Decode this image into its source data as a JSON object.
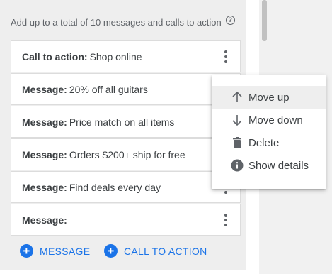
{
  "header": {
    "text": "Add up to a total of 10 messages and calls to action",
    "help_symbol": "?"
  },
  "rows": [
    {
      "label": "Call to action:",
      "value": "Shop online"
    },
    {
      "label": "Message:",
      "value": "20% off all guitars"
    },
    {
      "label": "Message:",
      "value": "Price match on all items"
    },
    {
      "label": "Message:",
      "value": "Orders $200+ ship for free"
    },
    {
      "label": "Message:",
      "value": "Find deals every day"
    },
    {
      "label": "Message:",
      "value": ""
    }
  ],
  "add_buttons": {
    "message": "MESSAGE",
    "call_to_action": "CALL TO ACTION",
    "plus_symbol": "+"
  },
  "menu": {
    "items": [
      {
        "label": "Move up",
        "icon": "arrow-up-icon"
      },
      {
        "label": "Move down",
        "icon": "arrow-down-icon"
      },
      {
        "label": "Delete",
        "icon": "trash-icon"
      },
      {
        "label": "Show details",
        "icon": "info-icon"
      }
    ],
    "highlighted_index": 0,
    "info_symbol": "i"
  },
  "colors": {
    "accent": "#1a73e8",
    "panel_bg": "#eeeeee",
    "text": "#3c4043"
  }
}
